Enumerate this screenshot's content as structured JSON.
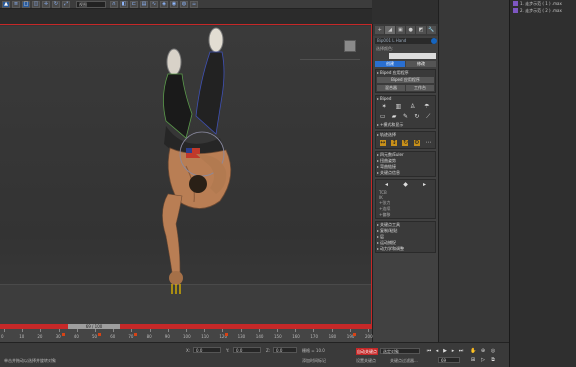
{
  "toolbar": {
    "coord_field": "视图",
    "icons": [
      "select-icon",
      "select-name-icon",
      "rect-select-icon",
      "window-crossing-icon",
      "move-icon",
      "rotate-icon",
      "scale-icon",
      "snap-icon",
      "mirror-icon",
      "align-icon",
      "layer-icon",
      "curve-icon",
      "schematic-icon",
      "material-icon",
      "render-setup-icon",
      "render-icon",
      "render-frame-icon"
    ]
  },
  "command_panel": {
    "tabs": [
      "+",
      "◢",
      "▣",
      "●",
      "◩",
      "🔧"
    ],
    "object_name": "Bip001 L Hand",
    "color_label": "选择颜色:",
    "buttons_top": [
      "创建",
      "修改"
    ],
    "rollouts": [
      {
        "title": "Biped 应用程序",
        "buttons": [
          "Biped 应用程序",
          "混合器",
          "工作台"
        ]
      },
      {
        "title": "Biped"
      },
      {
        "title": "+模式和显示"
      },
      {
        "title": "轨迹选择"
      },
      {
        "title": "四元数/Euler"
      },
      {
        "title": "扭曲姿势"
      },
      {
        "title": "弯曲链接"
      },
      {
        "title": "关键点信息"
      },
      {
        "title": "关键点工具"
      },
      {
        "title": "复制/粘贴"
      },
      {
        "title": "层"
      },
      {
        "title": "运动捕捉"
      },
      {
        "title": "动力学和调整"
      }
    ],
    "key_fields": [
      "TCB",
      "IK",
      "+张力",
      "+连续",
      "+偏移"
    ]
  },
  "scene_explorer": {
    "files": [
      "1. 走步示范 ( 1 ) .max",
      "2. 走步示范 ( 2 ) .max"
    ]
  },
  "timeline": {
    "frame_slider": "69 / 100",
    "tick_labels": [
      "0",
      "10",
      "20",
      "30",
      "40",
      "50",
      "60",
      "70",
      "80",
      "90",
      "100",
      "110",
      "120",
      "130",
      "140",
      "150",
      "160",
      "170",
      "180",
      "190",
      "200"
    ]
  },
  "statusbar": {
    "x_label": "X:",
    "x_val": "0.0",
    "y_label": "Y:",
    "y_val": "0.0",
    "z_label": "Z:",
    "z_val": "0.0",
    "grid": "栅格 = 10.0",
    "auto_key": "自动关键点",
    "set_key": "设置关键点",
    "selected": "选定对象",
    "key_filters": "关键点过滤器...",
    "frame": "69",
    "add_time": "添加时间标记",
    "prompt": "单击并拖动以选择并旋转对象"
  }
}
